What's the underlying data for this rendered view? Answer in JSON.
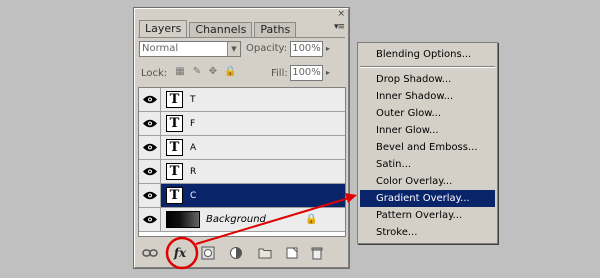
{
  "panel": {
    "tabs": [
      "Layers",
      "Channels",
      "Paths"
    ],
    "close_icon": "×",
    "menu_icon": "▾≡",
    "blend_mode": "Normal",
    "opacity_label": "Opacity:",
    "opacity_value": "100%",
    "lock_label": "Lock:",
    "fill_label": "Fill:",
    "fill_value": "100%"
  },
  "layers": [
    {
      "name": "T",
      "thumb": "T",
      "selected": false
    },
    {
      "name": "F",
      "thumb": "T",
      "selected": false
    },
    {
      "name": "A",
      "thumb": "T",
      "selected": false
    },
    {
      "name": "R",
      "thumb": "T",
      "selected": false
    },
    {
      "name": "C",
      "thumb": "T",
      "selected": true
    },
    {
      "name": "Background",
      "thumb": "gradient",
      "selected": false,
      "locked": true
    }
  ],
  "bottom_icons": [
    "link-icon",
    "fx-icon",
    "mask-icon",
    "adjustment-icon",
    "folder-icon",
    "new-layer-icon",
    "trash-icon"
  ],
  "fx_label": "fx",
  "menu": {
    "items": [
      "Blending Options...",
      "Drop Shadow...",
      "Inner Shadow...",
      "Outer Glow...",
      "Inner Glow...",
      "Bevel and Emboss...",
      "Satin...",
      "Color Overlay...",
      "Gradient Overlay...",
      "Pattern Overlay...",
      "Stroke..."
    ],
    "highlighted": "Gradient Overlay..."
  },
  "colors": {
    "selection": "#0a246a",
    "annotation": "#e00000",
    "panel_bg": "#d4d0c8",
    "page_bg": "#c0c0c0"
  }
}
